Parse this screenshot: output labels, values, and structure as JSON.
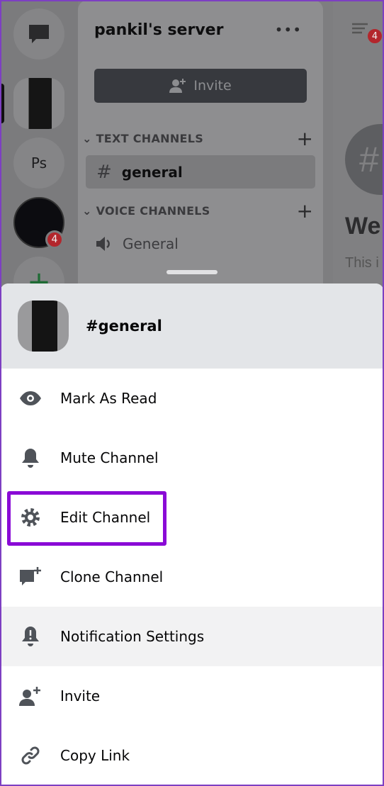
{
  "server": {
    "name": "pankil's server",
    "more_icon": "ellipsis-icon",
    "invite_label": "Invite",
    "text_category": "TEXT CHANNELS",
    "voice_category": "VOICE CHANNELS",
    "text_channel": "general",
    "voice_channel": "General"
  },
  "rail": {
    "ps_label": "Ps",
    "fifa_badge": "4"
  },
  "right": {
    "badge": "4",
    "welcome": "We",
    "desc": "This i"
  },
  "sheet": {
    "title": "#general",
    "items": [
      {
        "label": "Mark As Read",
        "icon": "eye-icon"
      },
      {
        "label": "Mute Channel",
        "icon": "bell-icon"
      },
      {
        "label": "Edit Channel",
        "icon": "gear-icon",
        "highlighted_box": true
      },
      {
        "label": "Clone Channel",
        "icon": "chat-plus-icon"
      },
      {
        "label": "Notification Settings",
        "icon": "bell-alert-icon",
        "pressed": true
      },
      {
        "label": "Invite",
        "icon": "user-plus-icon"
      },
      {
        "label": "Copy Link",
        "icon": "link-icon"
      }
    ]
  },
  "colors": {
    "highlight": "#8a0ad6",
    "badge": "#b3262c"
  }
}
